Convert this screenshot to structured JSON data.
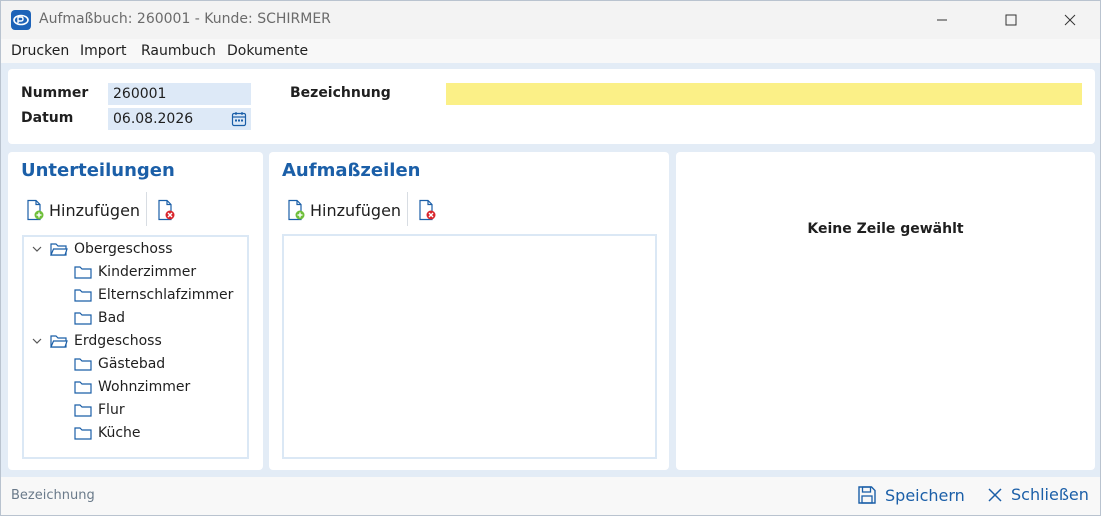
{
  "window": {
    "title": "Aufmaßbuch: 260001 - Kunde: SCHIRMER"
  },
  "menu": {
    "items": [
      "Drucken",
      "Import",
      "Raumbuch",
      "Dokumente"
    ]
  },
  "header": {
    "nummer_label": "Nummer",
    "nummer_value": "260001",
    "datum_label": "Datum",
    "datum_value": "06.08.2026",
    "bezeichnung_label": "Bezeichnung",
    "bezeichnung_value": ""
  },
  "unterteilungen": {
    "title": "Unterteilungen",
    "add_label": "Hinzufügen",
    "tree": [
      {
        "label": "Obergeschoss",
        "expanded": true,
        "children": [
          "Kinderzimmer",
          "Elternschlafzimmer",
          "Bad"
        ]
      },
      {
        "label": "Erdgeschoss",
        "expanded": true,
        "children": [
          "Gästebad",
          "Wohnzimmer",
          "Flur",
          "Küche"
        ]
      }
    ]
  },
  "aufmasszeilen": {
    "title": "Aufmaßzeilen",
    "add_label": "Hinzufügen"
  },
  "detail": {
    "empty_text": "Keine Zeile gewählt"
  },
  "status": {
    "text": "Bezeichnung",
    "save_label": "Speichern",
    "close_label": "Schließen"
  },
  "colors": {
    "accent": "#1b5fa8",
    "highlight_field": "#fbf087",
    "input_bg": "#dde9f7"
  },
  "icons": {
    "app": "app-logo-icon",
    "calendar": "calendar-icon",
    "add": "add-document-icon",
    "delete": "delete-document-icon",
    "folder": "folder-icon",
    "save": "save-icon",
    "close": "close-icon"
  }
}
